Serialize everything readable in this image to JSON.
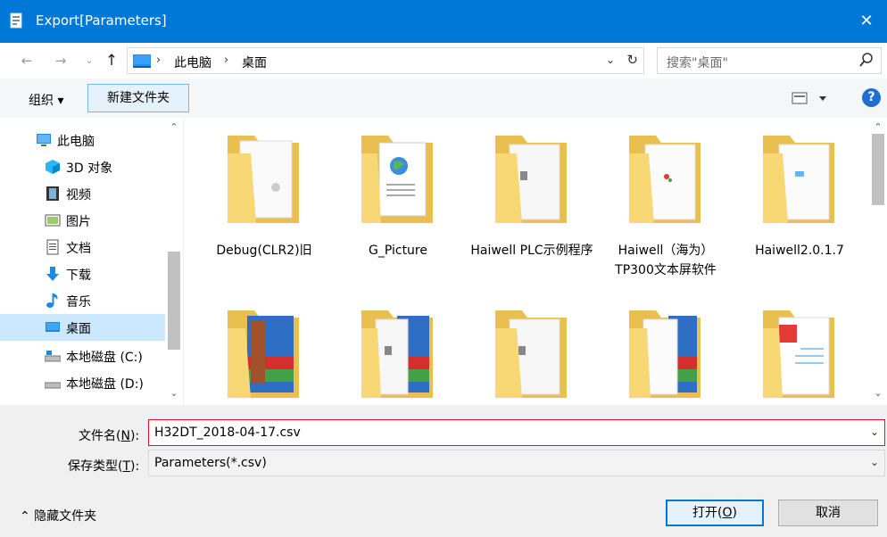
{
  "window": {
    "title": "Export[Parameters]",
    "close_symbol": "✕",
    "accent": "#0078d7"
  },
  "nav": {
    "back_symbol": "←",
    "forward_symbol": "→",
    "recent_symbol": "⌄",
    "up_symbol": "↑",
    "breadcrumb": [
      "此电脑",
      "桌面"
    ],
    "crumb_separator": "›",
    "dropdown_symbol": "⌄",
    "refresh_symbol": "↻",
    "search_placeholder": "搜索\"桌面\""
  },
  "toolbar": {
    "organize_label": "组织 ▾",
    "new_folder_label": "新建文件夹",
    "help_label": "?"
  },
  "sidebar": {
    "items": [
      {
        "label": "此电脑",
        "icon": "computer-icon"
      },
      {
        "label": "3D 对象",
        "icon": "cube-3d-icon"
      },
      {
        "label": "视频",
        "icon": "video-icon"
      },
      {
        "label": "图片",
        "icon": "picture-icon"
      },
      {
        "label": "文档",
        "icon": "document-icon"
      },
      {
        "label": "下载",
        "icon": "download-icon"
      },
      {
        "label": "音乐",
        "icon": "music-icon"
      },
      {
        "label": "桌面",
        "icon": "desktop-icon",
        "selected": true
      },
      {
        "label": "本地磁盘 (C:)",
        "icon": "drive-c-icon"
      },
      {
        "label": "本地磁盘 (D:)",
        "icon": "drive-d-icon"
      }
    ],
    "scroll_up": "⌃",
    "scroll_down": "⌄"
  },
  "files": [
    {
      "name": "Debug(CLR2)旧",
      "preview": "gear"
    },
    {
      "name": "G_Picture",
      "preview": "globe-page"
    },
    {
      "name": "Haiwell PLC示例程序",
      "preview": "doc"
    },
    {
      "name": "Haiwell（海为）TP300文本屏软件",
      "preview": "app"
    },
    {
      "name": "Haiwell2.0.1.7",
      "preview": "screen"
    },
    {
      "name": "",
      "preview": "archive"
    },
    {
      "name": "",
      "preview": "doc-archive"
    },
    {
      "name": "",
      "preview": "doc"
    },
    {
      "name": "",
      "preview": "archive-plain"
    },
    {
      "name": "",
      "preview": "pdf"
    }
  ],
  "form": {
    "filename_label": "文件名(",
    "filename_accel": "N",
    "filename_label_end": "):",
    "filename_value": "H32DT_2018-04-17.csv",
    "filetype_label": "保存类型(",
    "filetype_accel": "T",
    "filetype_label_end": "):",
    "filetype_value": "Parameters(*.csv)",
    "dropdown_symbol": "⌄"
  },
  "footer": {
    "hide_folders_label": "⌃  隐藏文件夹",
    "open_label": "打开(",
    "open_accel": "O",
    "open_label_end": ")",
    "cancel_label": "取消"
  },
  "colors": {
    "folder": "#f8d775",
    "folder_dark": "#e9bf4f",
    "selected_bg": "#cce8ff",
    "error_border": "#e81123"
  }
}
